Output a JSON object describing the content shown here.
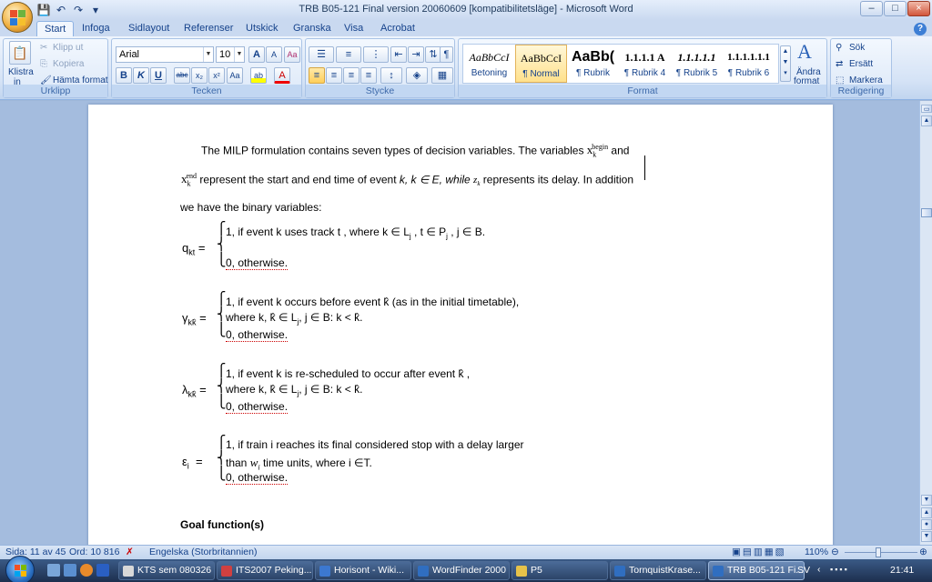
{
  "window": {
    "title": "TRB B05-121 Final version 20060609 [kompatibilitetsläge] - Microsoft Word",
    "min": "–",
    "max": "□",
    "close": "×"
  },
  "qat": {
    "save": "💾",
    "undo": "↶",
    "redo": "↷",
    "custom": "▾"
  },
  "tabs": [
    "Start",
    "Infoga",
    "Sidlayout",
    "Referenser",
    "Utskick",
    "Granska",
    "Visa",
    "Acrobat"
  ],
  "ribbon": {
    "clipboard": {
      "paste": "Klistra",
      "paste2": "in",
      "cut": "Klipp ut",
      "copy": "Kopiera",
      "format_painter": "Hämta format",
      "label": "Urklipp"
    },
    "font": {
      "name": "Arial",
      "size": "10",
      "grow": "A",
      "shrink": "A",
      "clear": "Aa",
      "label": "Tecken",
      "bold": "B",
      "italic": "K",
      "underline": "U",
      "strike": "abc",
      "sub": "x₂",
      "sup": "x²",
      "case": "Aa",
      "highlight": "ab",
      "color": "A"
    },
    "paragraph": {
      "label": "Stycke",
      "pilcrow": "¶"
    },
    "styles": {
      "items": [
        {
          "preview": "AaBbCcI",
          "name": "Betoning"
        },
        {
          "preview": "AaBbCcI",
          "name": "¶ Normal"
        },
        {
          "preview": "AaBb(",
          "name": "¶ Rubrik"
        },
        {
          "preview": "1.1.1.1 A",
          "name": "¶ Rubrik 4"
        },
        {
          "preview": "1.1.1.1.1",
          "name": "¶ Rubrik 5"
        },
        {
          "preview": "1.1.1.1.1.1",
          "name": "¶ Rubrik 6"
        }
      ],
      "change_line1": "Ändra",
      "change_line2": "format",
      "label": "Format"
    },
    "editing": {
      "find": "Sök",
      "replace": "Ersätt",
      "select": "Markera",
      "label": "Redigering"
    }
  },
  "doc": {
    "p1_a": "The MILP formulation contains seven types of decision variables. The variables",
    "p1_and": "and",
    "p2_a": "represent the start and end time of event",
    "p2_b": "k, k ∈ E, while",
    "p2_c": "represents its delay. In addition",
    "p3": "we have the binary variables:",
    "x": "x",
    "k": "k",
    "sup_begin": "begin",
    "sup_end": "end",
    "z": "z",
    "q_label": "q",
    "q_sub": "kt",
    "q_l1": "1, if event k uses track t , where k ∈ L",
    "q_l1b": "j",
    "q_l1c": " , t ∈ P",
    "q_l1d": "j",
    "q_l1e": " , j ∈ B.",
    "otherwise": "0, otherwise.",
    "g_label": "γ",
    "g_sub": "kk̂",
    "g_l1": "1, if event k occurs before event k̂ (as in the initial timetable),",
    "g_l2": "where k, k̂ ∈ L",
    "g_l2b": "j",
    "g_l2c": ", j ∈ B: k < k̂.",
    "l_label": "λ",
    "l_sub": "kk̂",
    "l_l1": "1, if event k is re-scheduled to occur after event k̂ ,",
    "l_l2": "where k, k̂ ∈ L",
    "l_l2b": "j",
    "l_l2c": ", j ∈ B: k < k̂.",
    "e_label": "ε",
    "e_sub": "i",
    "e_l1": "1, if train i reaches its final considered stop with a delay larger",
    "e_l2a": "than",
    "e_w": "w",
    "e_wsub": "i",
    "e_l2b": "time units, where i ∈T.",
    "eq": "=",
    "heading": "Goal function(s)"
  },
  "status": {
    "page": "Sida: 11 av 45",
    "words": "Ord: 10 816",
    "language": "Engelska (Storbritannien)",
    "zoom": "110%"
  },
  "taskbar": {
    "tasks": [
      "KTS sem 080326",
      "ITS2007 Peking...",
      "Horisont - Wiki...",
      "WordFinder 2000",
      "P5",
      "TornquistKrase...",
      "TRB B05-121 Fi..."
    ],
    "lang": "SV",
    "time": "21:41"
  },
  "colors": {
    "ribbon_text": "#15428b",
    "taskbar": "#1d2f4e",
    "page": "#ffffff"
  }
}
